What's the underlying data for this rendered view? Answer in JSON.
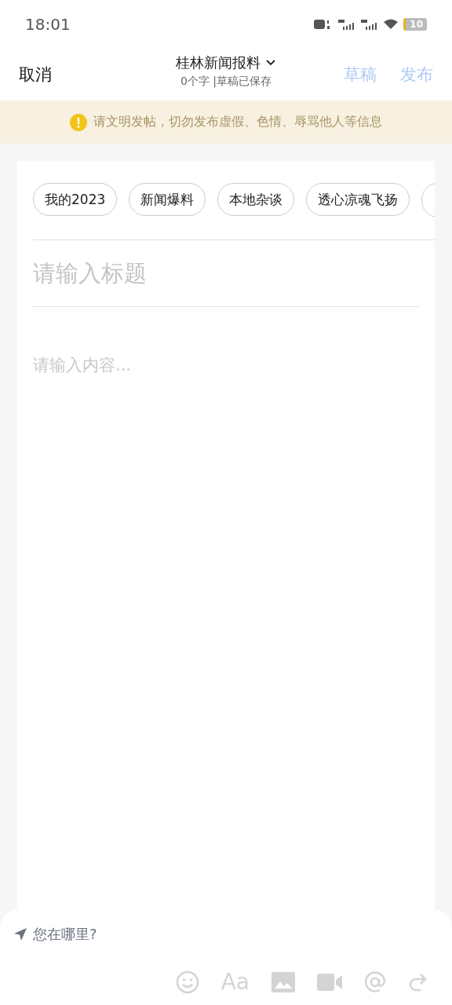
{
  "status_bar": {
    "time": "18:01",
    "battery": "10"
  },
  "header": {
    "cancel": "取消",
    "title": "桂林新闻报料",
    "subtitle": "0个字 |草稿已保存",
    "actions": [
      {
        "label": "草稿",
        "disabled": true
      },
      {
        "label": "发布",
        "disabled": true
      }
    ]
  },
  "notice": "请文明发帖，切勿发布虚假、色情、辱骂他人等信息",
  "topics": [
    {
      "label": "我的2023"
    },
    {
      "label": "新闻爆料"
    },
    {
      "label": "本地杂谈"
    },
    {
      "label": "透心凉魂飞扬"
    }
  ],
  "title_field": {
    "placeholder": "请输入标题"
  },
  "content_field": {
    "placeholder": "请输入内容..."
  },
  "location": "您在哪里?",
  "toolbar": [
    {
      "kind": "emoji"
    },
    {
      "kind": "text",
      "label": "Aa"
    },
    {
      "kind": "image"
    },
    {
      "kind": "video"
    },
    {
      "kind": "at"
    },
    {
      "kind": "redo"
    }
  ]
}
